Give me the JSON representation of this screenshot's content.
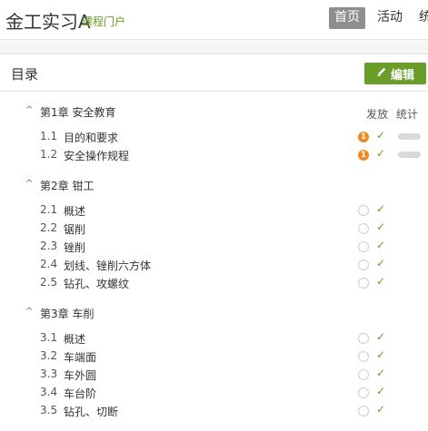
{
  "header": {
    "title": "金工实习A",
    "portal": "课程门户",
    "nav": [
      "首页",
      "活动",
      "统"
    ]
  },
  "toc": {
    "title": "目录",
    "edit_label": "编辑",
    "columns": {
      "publish": "发放",
      "stats": "统计"
    }
  },
  "chapters": [
    {
      "label": "第1章 安全教育",
      "items": [
        {
          "num": "1.1",
          "name": "目的和要求",
          "badge": "1"
        },
        {
          "num": "1.2",
          "name": "安全操作规程",
          "badge": "1"
        }
      ]
    },
    {
      "label": "第2章 钳工",
      "items": [
        {
          "num": "2.1",
          "name": "概述"
        },
        {
          "num": "2.2",
          "name": "锯削"
        },
        {
          "num": "2.3",
          "name": "锉削"
        },
        {
          "num": "2.4",
          "name": "划线、锉削六方体"
        },
        {
          "num": "2.5",
          "name": "钻孔、攻螺纹"
        }
      ]
    },
    {
      "label": "第3章 车削",
      "items": [
        {
          "num": "3.1",
          "name": "概述"
        },
        {
          "num": "3.2",
          "name": "车端面"
        },
        {
          "num": "3.3",
          "name": "车外圆"
        },
        {
          "num": "3.4",
          "name": "车台阶"
        },
        {
          "num": "3.5",
          "name": "钻孔、切断"
        }
      ]
    }
  ],
  "glyphs": {
    "caret": "^",
    "check": "✓"
  },
  "colors": {
    "accent": "#6a9d2a",
    "alert": "#f08a24",
    "nav_active": "#8e8e8e"
  }
}
